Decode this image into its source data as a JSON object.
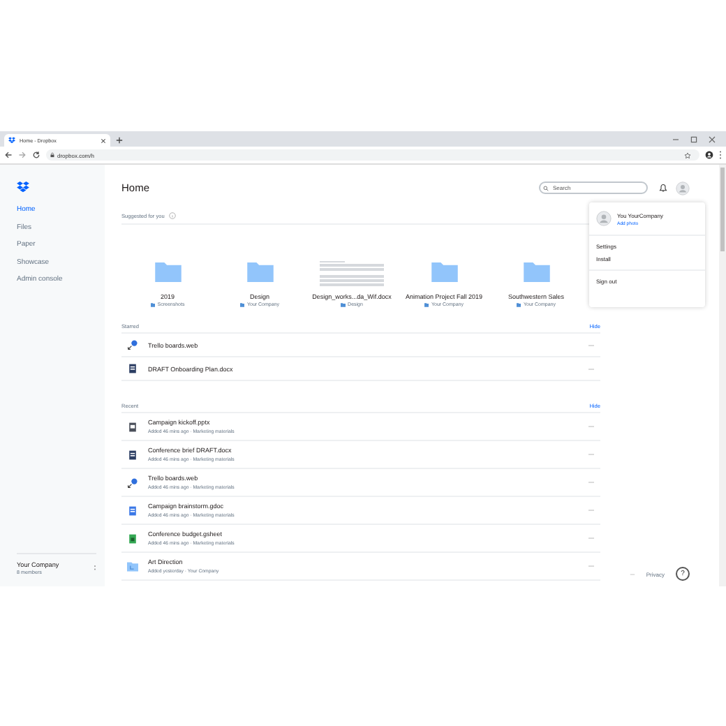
{
  "browser": {
    "tab_title": "Home - Dropbox",
    "url": "dropbox.com/h"
  },
  "sidebar": {
    "items": [
      {
        "label": "Home",
        "selected": true
      },
      {
        "label": "Files",
        "selected": false
      },
      {
        "label": "Paper",
        "selected": false
      },
      {
        "label": "Showcase",
        "selected": false
      },
      {
        "label": "Admin console",
        "selected": false
      }
    ],
    "team": {
      "name": "Your Company",
      "members": "8 members"
    }
  },
  "header": {
    "title": "Home",
    "search": {
      "placeholder": "Search"
    }
  },
  "suggested": {
    "label": "Suggested for you",
    "items": [
      {
        "kind": "folder",
        "name": "2019",
        "location": "Screenshots"
      },
      {
        "kind": "folder",
        "name": "Design",
        "location": "Your Company"
      },
      {
        "kind": "document",
        "name": "Design_works...da_Wif.docx",
        "location": "Design"
      },
      {
        "kind": "folder",
        "name": "Animation Project Fall 2019",
        "location": "Your Company"
      },
      {
        "kind": "folder",
        "name": "Southwestern Sales",
        "location": "Your Company"
      }
    ]
  },
  "starred": {
    "label": "Starred",
    "action": "Hide",
    "items": [
      {
        "kind": "web",
        "name": "Trello boards.web"
      },
      {
        "kind": "docx",
        "name": "DRAFT Onboarding Plan.docx"
      }
    ]
  },
  "recent": {
    "label": "Recent",
    "action": "Hide",
    "items": [
      {
        "kind": "pptx",
        "name": "Campaign kickoff.pptx",
        "detail": "Added 46 mins ago · Marketing materials"
      },
      {
        "kind": "docx",
        "name": "Conference brief DRAFT.docx",
        "detail": "Added 46 mins ago · Marketing materials"
      },
      {
        "kind": "web",
        "name": "Trello boards.web",
        "detail": "Added 46 mins ago · Marketing materials"
      },
      {
        "kind": "gdoc",
        "name": "Campaign brainstorm.gdoc",
        "detail": "Added 46 mins ago · Marketing materials"
      },
      {
        "kind": "gsheet",
        "name": "Conference budget.gsheet",
        "detail": "Added 46 mins ago · Marketing materials"
      },
      {
        "kind": "folder",
        "name": "Art Direction",
        "detail": "Added yesterday · Your Company"
      }
    ]
  },
  "account_menu": {
    "name": "You YourCompany",
    "add_photo": "Add photo",
    "items": [
      "Settings",
      "Install"
    ],
    "sign_out": "Sign out"
  },
  "footer": {
    "privacy": "Privacy",
    "help": "?"
  }
}
